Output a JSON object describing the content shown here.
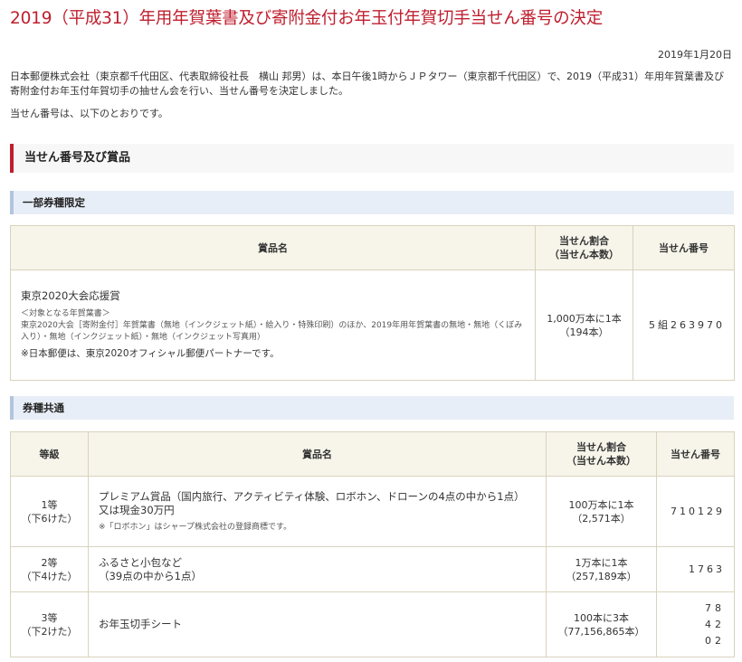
{
  "page": {
    "title": "2019（平成31）年用年賀葉書及び寄附金付お年玉付年賀切手当せん番号の決定",
    "date": "2019年1月20日",
    "intro": "日本郵便株式会社（東京都千代田区、代表取締役社長　横山 邦男）は、本日午後1時からＪＰタワー（東京都千代田区）で、2019（平成31）年用年賀葉書及び寄附金付お年玉付年賀切手の抽せん会を行い、当せん番号を決定しました。",
    "intro2": "当せん番号は、以下のとおりです。",
    "section_heading": "当せん番号及び賞品"
  },
  "limited": {
    "heading": "一部券種限定",
    "headers": {
      "prize": "賞品名",
      "ratio_line1": "当せん割合",
      "ratio_line2": "（当せん本数）",
      "number": "当せん番号"
    },
    "row": {
      "prize_name": "東京2020大会応援賞",
      "note_head": "＜対象となる年賀葉書＞",
      "note_body": "東京2020大会［寄附金付］年賀葉書（無地（インクジェット紙）・絵入り・特殊印刷）のほか、2019年用年賀葉書の無地・無地（くぼみ入り）・無地（インクジェット紙）・無地（インクジェット写真用）",
      "partner_note": "※日本郵便は、東京2020オフィシャル郵便パートナーです。",
      "ratio_line1": "1,000万本に1本",
      "ratio_line2": "（194本）",
      "number": "5組263970"
    }
  },
  "common": {
    "heading": "券種共通",
    "headers": {
      "grade": "等級",
      "prize": "賞品名",
      "ratio_line1": "当せん割合",
      "ratio_line2": "（当せん本数）",
      "number": "当せん番号"
    },
    "rows": [
      {
        "grade": "1等",
        "digits": "（下6けた）",
        "prize_line1": "プレミアム賞品（国内旅行、アクティビティ体験、ロボホン、ドローンの4点の中から1点）",
        "prize_line2": "又は現金30万円",
        "note": "※「ロボホン」はシャープ株式会社の登録商標です。",
        "ratio_line1": "100万本に1本",
        "ratio_line2": "（2,571本）",
        "number": "710129"
      },
      {
        "grade": "2等",
        "digits": "（下4けた）",
        "prize_line1": "ふるさと小包など",
        "prize_line2": "（39点の中から1点）",
        "ratio_line1": "1万本に1本",
        "ratio_line2": "（257,189本）",
        "number": "1763"
      },
      {
        "grade": "3等",
        "digits": "（下2けた）",
        "prize_line1": "お年玉切手シート",
        "ratio_line1": "100本に3本",
        "ratio_line2": "（77,156,865本）",
        "numbers": [
          "78",
          "42",
          "02"
        ]
      }
    ]
  }
}
